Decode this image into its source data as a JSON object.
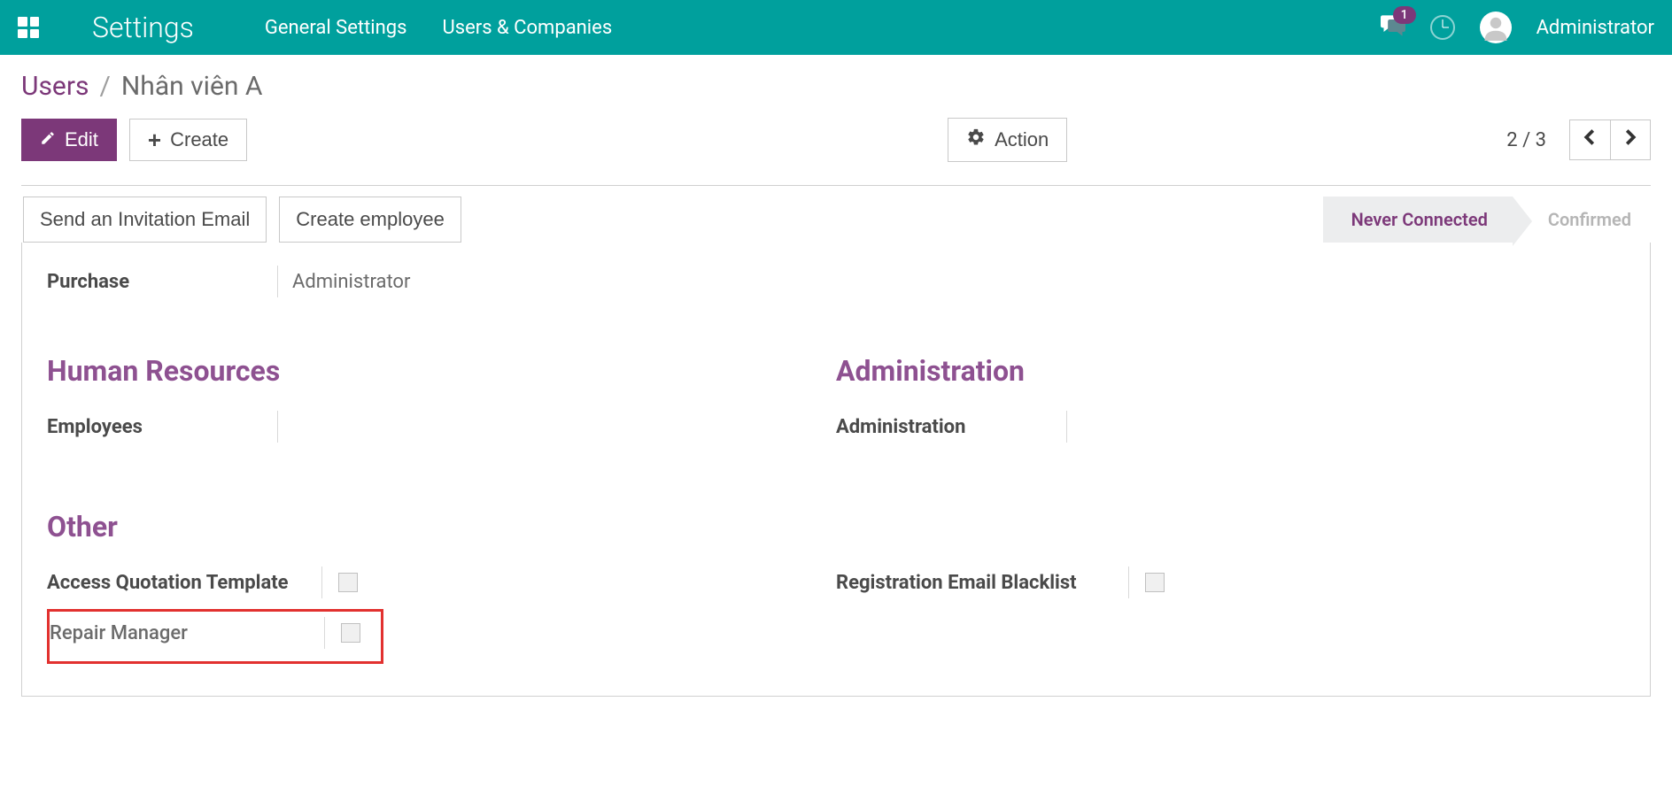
{
  "topbar": {
    "app_title": "Settings",
    "nav": {
      "general": "General Settings",
      "users_companies": "Users & Companies"
    },
    "chat_badge": "1",
    "user_name": "Administrator"
  },
  "breadcrumb": {
    "link": "Users",
    "sep": "/",
    "current": "Nhân viên A"
  },
  "buttons": {
    "edit": "Edit",
    "create": "Create",
    "action": "Action"
  },
  "pager": {
    "text": "2 / 3"
  },
  "statusbar": {
    "send_invite": "Send an Invitation Email",
    "create_employee": "Create employee",
    "never_connected": "Never Connected",
    "confirmed": "Confirmed"
  },
  "fields": {
    "purchase_label": "Purchase",
    "purchase_value": "Administrator"
  },
  "sections": {
    "hr": {
      "heading": "Human Resources",
      "employees": "Employees"
    },
    "admin": {
      "heading": "Administration",
      "administration": "Administration"
    },
    "other": {
      "heading": "Other",
      "access_quotation": "Access Quotation Template",
      "repair_manager": "Repair Manager",
      "reg_email_blacklist": "Registration Email Blacklist"
    }
  }
}
